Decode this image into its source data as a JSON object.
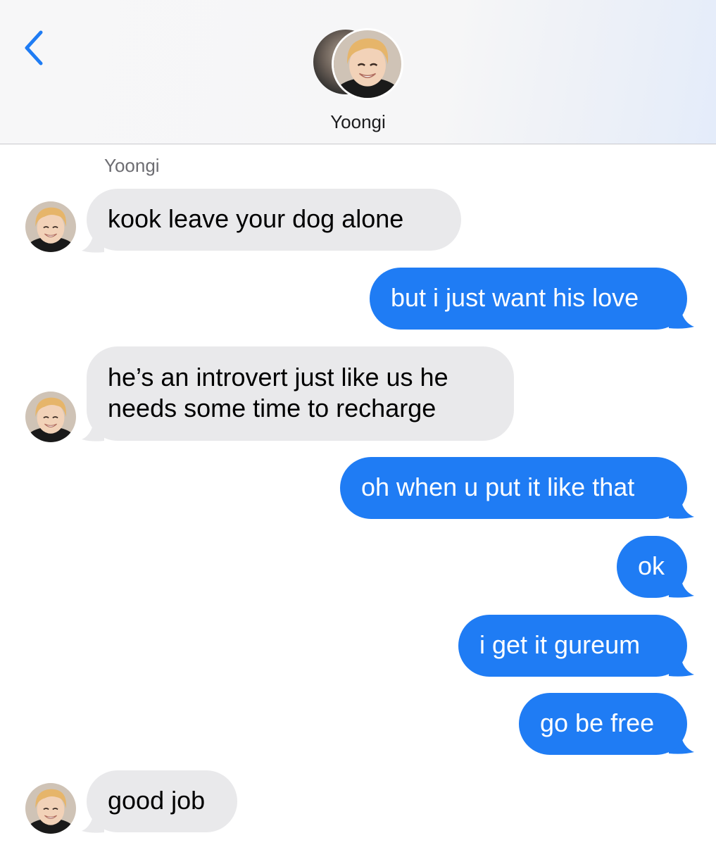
{
  "header": {
    "contact_name": "Yoongi",
    "back_icon": "chevron-left-icon",
    "accent_color": "#1f7cf4"
  },
  "thread": {
    "sender_label": "Yoongi",
    "messages": [
      {
        "direction": "incoming",
        "text": "kook leave your dog alone",
        "avatar": true
      },
      {
        "direction": "outgoing",
        "text": "but i just want his love"
      },
      {
        "direction": "incoming",
        "lines": [
          "he’s an introvert just like us he",
          "needs some time to recharge"
        ],
        "avatar": true
      },
      {
        "direction": "outgoing",
        "text": "oh when u put it like that"
      },
      {
        "direction": "outgoing",
        "text": "ok"
      },
      {
        "direction": "outgoing",
        "text": "i get it gureum"
      },
      {
        "direction": "outgoing",
        "text": "go be free"
      },
      {
        "direction": "incoming",
        "text": "good job",
        "avatar": true
      }
    ]
  },
  "colors": {
    "incoming_bubble": "#e9e9eb",
    "outgoing_bubble": "#1f7cf4",
    "header_bg": "#f7f7f8"
  }
}
